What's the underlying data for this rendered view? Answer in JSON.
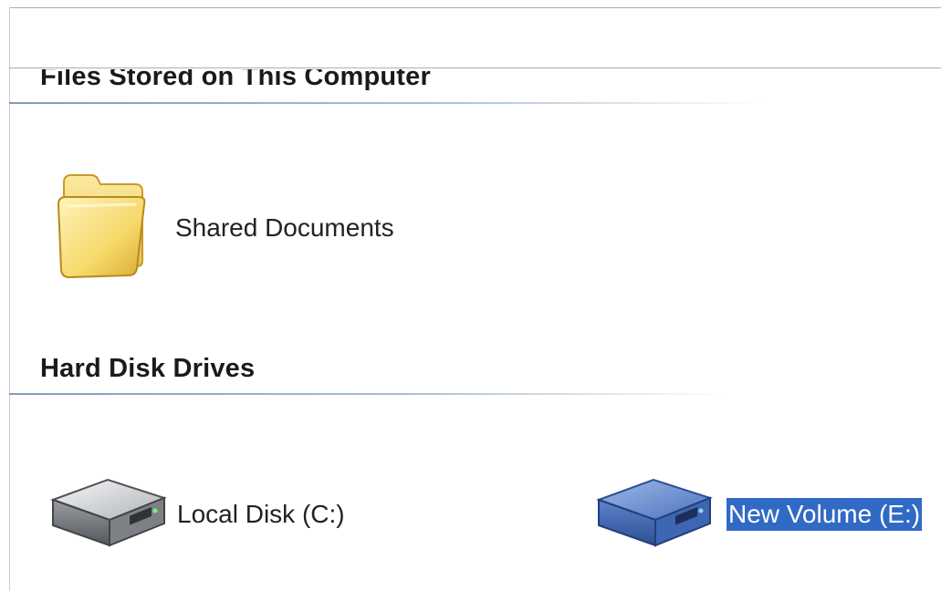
{
  "groups": {
    "files": {
      "title": "Files Stored on This Computer"
    },
    "hdd": {
      "title": "Hard Disk Drives"
    }
  },
  "items": {
    "shared_documents": {
      "label": "Shared Documents",
      "icon": "folder-icon",
      "selected": false
    },
    "local_disk_c": {
      "label": "Local Disk (C:)",
      "icon": "hard-disk-icon",
      "selected": false
    },
    "new_volume_e": {
      "label": "New Volume (E:)",
      "icon": "hard-disk-icon",
      "selected": true
    }
  },
  "colors": {
    "selection": "#316ac5",
    "folder": "#f3d66a",
    "drive_gray": "#b5b8bc",
    "drive_selected": "#4d79c7",
    "group_rule": "#7f9db9"
  }
}
